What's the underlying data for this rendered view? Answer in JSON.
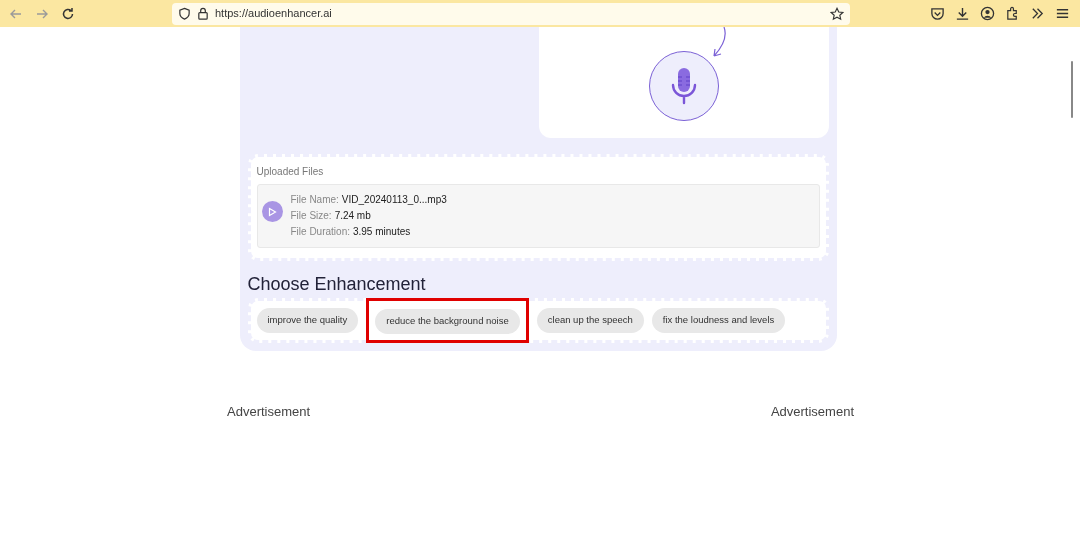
{
  "browser": {
    "url": "https://audioenhancer.ai"
  },
  "uploaded_files": {
    "title": "Uploaded Files",
    "file": {
      "fields": [
        {
          "label": "File Name:",
          "value": "VID_20240113_0...mp3"
        },
        {
          "label": "File Size:",
          "value": "7.24 mb"
        },
        {
          "label": "File Duration:",
          "value": "3.95 minutes"
        }
      ]
    }
  },
  "enhancement": {
    "title": "Choose Enhancement",
    "options": [
      {
        "label": "improve the quality",
        "highlighted": false
      },
      {
        "label": "reduce the background noise",
        "highlighted": true
      },
      {
        "label": "clean up the speech",
        "highlighted": false
      },
      {
        "label": "fix the loudness and levels",
        "highlighted": false
      }
    ]
  },
  "ads": [
    "Advertisement",
    "Advertisement"
  ]
}
